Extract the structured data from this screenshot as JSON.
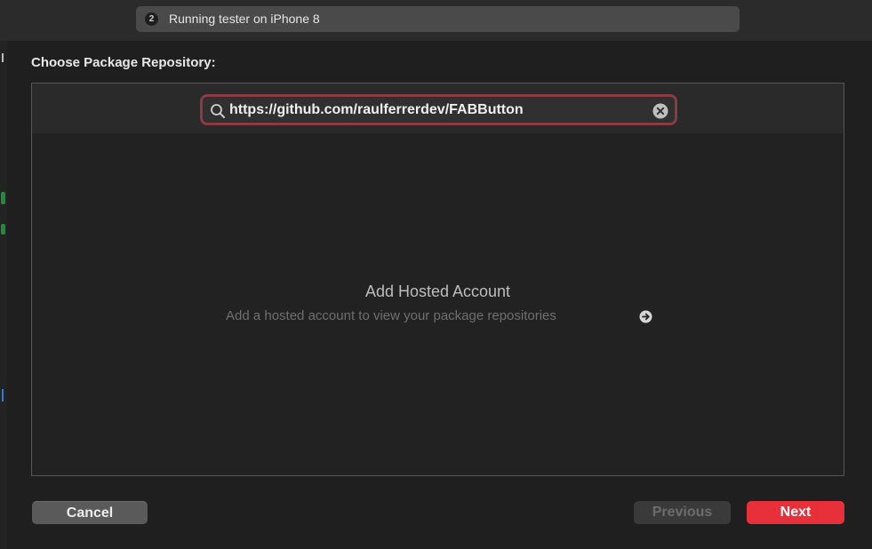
{
  "toolbar": {
    "activity_badge": "2",
    "activity_status": "Running tester on iPhone 8"
  },
  "sheet": {
    "title": "Choose Package Repository:",
    "search": {
      "value": "https://github.com/raulferrerdev/FABButton",
      "icon": "search-icon",
      "clear_icon": "clear-circle-icon"
    },
    "empty_state": {
      "title": "Add Hosted Account",
      "subtitle": "Add a hosted account to view your package repositories",
      "arrow_icon": "arrow-circle-right-icon"
    },
    "buttons": {
      "cancel": "Cancel",
      "previous": "Previous",
      "next": "Next"
    }
  },
  "colors": {
    "accent": "#e8303b",
    "focus_ring": "#8c3a44"
  }
}
